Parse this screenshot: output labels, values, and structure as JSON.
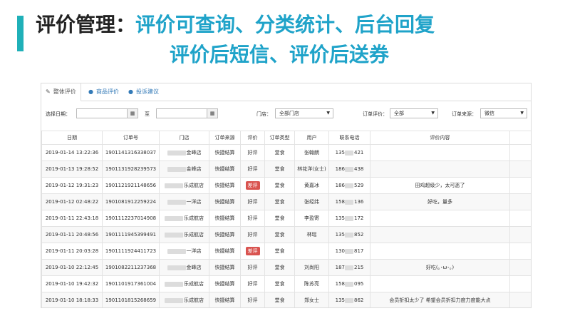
{
  "header": {
    "title": "评价管理：",
    "features_line1": "评价可查询、分类统计、后台回复",
    "features_line2": "评价后短信、评价后送券",
    "accent_color": "#1fb0b8"
  },
  "tabs": [
    {
      "label": "整体评价",
      "icon": "comments-icon",
      "active": true
    },
    {
      "label": "商品评价",
      "icon": "user-icon",
      "active": false
    },
    {
      "label": "投诉建议",
      "icon": "user-icon",
      "active": false
    }
  ],
  "filters": {
    "date_label": "选择日期：",
    "date_sep": "至",
    "store_label": "门店：",
    "store_value": "全部门店",
    "rating_label": "订单评价：",
    "rating_value": "全部",
    "source_label": "订单来源：",
    "source_value": "微信"
  },
  "table": {
    "headers": [
      "日期",
      "订单号",
      "门店",
      "订单来源",
      "评价",
      "订单类型",
      "用户",
      "联系电话",
      "评价内容"
    ],
    "rows": [
      {
        "date": "2019-01-14 13:22:36",
        "order": "1901141316338037",
        "store": "金峰店",
        "source": "快捷结算",
        "rating": "好评",
        "bad": false,
        "type": "堂食",
        "user": "张翰朗",
        "phone_pre": "135",
        "phone_suf": "421",
        "content": ""
      },
      {
        "date": "2019-01-13 19:28:52",
        "order": "1901131928239573",
        "store": "金峰店",
        "source": "快捷结算",
        "rating": "好评",
        "bad": false,
        "type": "堂食",
        "user": "林花洋(女士)",
        "phone_pre": "186",
        "phone_suf": "438",
        "content": ""
      },
      {
        "date": "2019-01-12 19:31:23",
        "order": "1901121921148656",
        "store": "乐成航店",
        "source": "快捷结算",
        "rating": "差评",
        "bad": true,
        "type": "堂食",
        "user": "黄嘉冰",
        "phone_pre": "186",
        "phone_suf": "529",
        "content": "田鸡超级少，太可恶了"
      },
      {
        "date": "2019-01-12 02:48:22",
        "order": "1901081912259224",
        "store": "一洋店",
        "source": "快捷结算",
        "rating": "好评",
        "bad": false,
        "type": "堂食",
        "user": "张经纬",
        "phone_pre": "158",
        "phone_suf": "136",
        "content": "好吃，量多"
      },
      {
        "date": "2019-01-11 22:43:18",
        "order": "1901112237014908",
        "store": "乐成航店",
        "source": "快捷结算",
        "rating": "好评",
        "bad": false,
        "type": "堂食",
        "user": "李盈寄",
        "phone_pre": "135",
        "phone_suf": "172",
        "content": ""
      },
      {
        "date": "2019-01-11 20:48:56",
        "order": "1901111945399491",
        "store": "乐成航店",
        "source": "快捷结算",
        "rating": "好评",
        "bad": false,
        "type": "堂食",
        "user": "林瑶",
        "phone_pre": "135",
        "phone_suf": "852",
        "content": ""
      },
      {
        "date": "2019-01-11 20:03:28",
        "order": "1901111924411723",
        "store": "一洋店",
        "source": "快捷结算",
        "rating": "差评",
        "bad": true,
        "type": "堂食",
        "user": "",
        "phone_pre": "130",
        "phone_suf": "817",
        "content": ""
      },
      {
        "date": "2019-01-10 22:12:45",
        "order": "1901082211237368",
        "store": "金峰店",
        "source": "快捷结算",
        "rating": "好评",
        "bad": false,
        "type": "堂食",
        "user": "刘尚阳",
        "phone_pre": "187",
        "phone_suf": "215",
        "content": "好吃(｡･ω･｡)"
      },
      {
        "date": "2019-01-10 19:42:32",
        "order": "1901101917361004",
        "store": "乐成航店",
        "source": "快捷结算",
        "rating": "好评",
        "bad": false,
        "type": "堂食",
        "user": "陈苏亮",
        "phone_pre": "158",
        "phone_suf": "095",
        "content": ""
      },
      {
        "date": "2019-01-10 18:18:33",
        "order": "1901101815268659",
        "store": "乐成航店",
        "source": "快捷结算",
        "rating": "好评",
        "bad": false,
        "type": "堂食",
        "user": "郑女士",
        "phone_pre": "135",
        "phone_suf": "862",
        "content": "会员折扣太少了 希望会员折扣力度力度能大点"
      }
    ]
  },
  "colors": {
    "bad_badge": "#d9534f",
    "link": "#337ab7",
    "title_feature": "#1fa3c9"
  }
}
